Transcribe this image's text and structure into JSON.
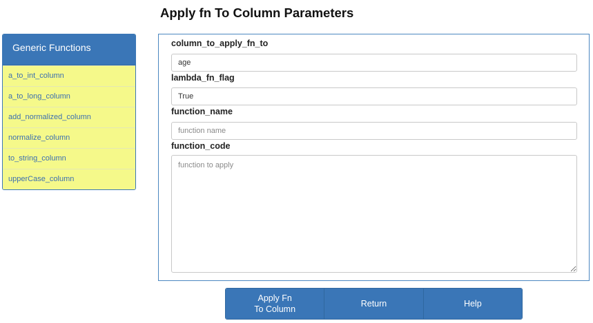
{
  "page": {
    "title": "Apply fn To Column Parameters"
  },
  "sidebar": {
    "header": "Generic Functions",
    "items": [
      {
        "label": "a_to_int_column"
      },
      {
        "label": "a_to_long_column"
      },
      {
        "label": "add_normalized_column"
      },
      {
        "label": "normalize_column"
      },
      {
        "label": "to_string_column"
      },
      {
        "label": "upperCase_column"
      }
    ]
  },
  "form": {
    "column_to_apply_fn_to": {
      "label": "column_to_apply_fn_to",
      "value": "age",
      "placeholder": ""
    },
    "lambda_fn_flag": {
      "label": "lambda_fn_flag",
      "value": "True",
      "placeholder": ""
    },
    "function_name": {
      "label": "function_name",
      "value": "",
      "placeholder": "function name"
    },
    "function_code": {
      "label": "function_code",
      "value": "",
      "placeholder": "function to apply"
    }
  },
  "buttons": {
    "apply_label": "Apply Fn\nTo Column",
    "return_label": "Return",
    "help_label": "Help"
  },
  "colors": {
    "accent_blue": "#3a76b7",
    "sidebar_item_bg": "#f5f98a",
    "sidebar_item_text": "#3c6fb0"
  }
}
